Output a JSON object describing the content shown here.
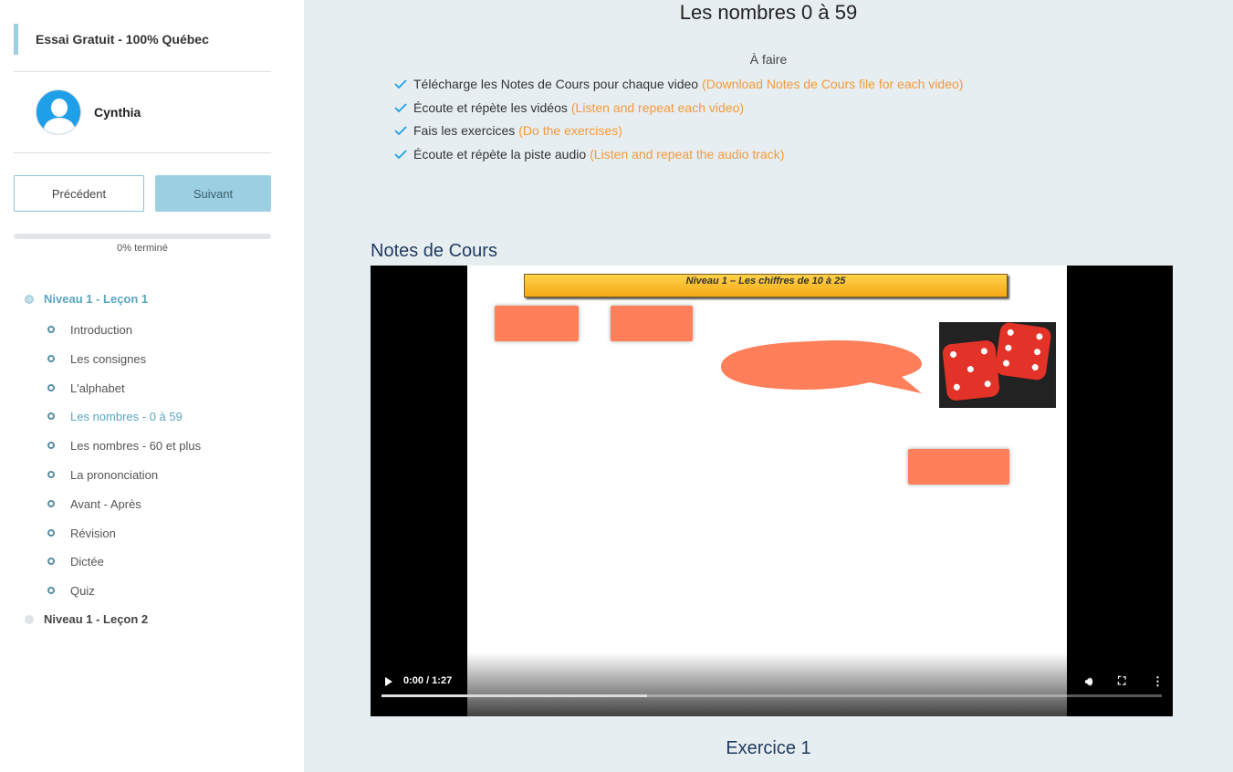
{
  "sidebar": {
    "course_title": "Essai Gratuit - 100% Québec",
    "user_name": "Cynthia",
    "prev_label": "Précédent",
    "next_label": "Suivant",
    "progress_text": "0% terminé",
    "progress_fraction": 0,
    "lessons": [
      {
        "label": "Niveau 1 - Leçon 1",
        "topics": [
          "Introduction",
          "Les consignes",
          "L'alphabet",
          "Les nombres - 0 à 59",
          "Les nombres - 60 et plus",
          "La prononciation",
          "Avant - Après",
          "Révision",
          "Dictée",
          "Quiz"
        ],
        "active_topic": "Les nombres - 0 à 59"
      },
      {
        "label": "Niveau 1 - Leçon 2"
      }
    ]
  },
  "main": {
    "title": "Les nombres 0 à 59",
    "todo_heading": "À faire",
    "todo": [
      {
        "fr": "Télécharge les Notes de Cours pour chaque video",
        "en": "(Download Notes de Cours file for each video)"
      },
      {
        "fr": "Écoute et répète les vidéos",
        "en": "(Listen and repeat each video)"
      },
      {
        "fr": "Fais les exercices",
        "en": "(Do the exercises)"
      },
      {
        "fr": "Écoute et répète la piste audio",
        "en": "(Listen and repeat the audio track)"
      }
    ],
    "notes_title": "Notes de Cours",
    "video": {
      "slide_header": "Niveau 1 – Les chiffres de 10 à 25",
      "time": "0:00 / 1:27",
      "played_fraction": 0.34
    },
    "exercise_title": "Exercice 1"
  },
  "colors": {
    "accent": "#9bcfe1",
    "active_link": "#5ba6c1",
    "translation": "#f39a3b",
    "heading": "#1f3a5f",
    "check": "#1e9fe8"
  }
}
